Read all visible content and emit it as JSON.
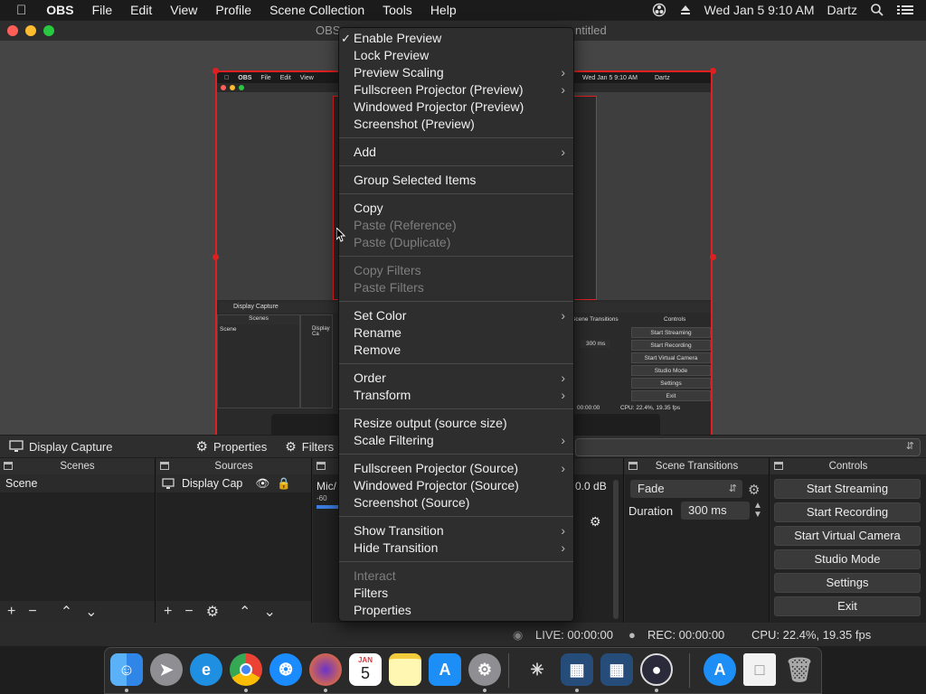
{
  "menubar": {
    "app": "OBS",
    "items": [
      "File",
      "Edit",
      "View",
      "Profile",
      "Scene Collection",
      "Tools",
      "Help"
    ],
    "datetime": "Wed Jan 5  9:10 AM",
    "user": "Dartz"
  },
  "window": {
    "title": "OBS",
    "title_suffix": "ntitled"
  },
  "preview_mini": {
    "menubar": [
      "OBS",
      "File",
      "Edit",
      "View"
    ],
    "datetime": "Wed Jan 5  9:10 AM",
    "user": "Dartz",
    "display_capture": "Display Capture",
    "scenes": "Scenes",
    "scene": "Scene",
    "display_cap": "Display Ca",
    "scene_transitions": "Scene Transitions",
    "controls": "Controls",
    "duration": "300 ms",
    "start_streaming": "Start Streaming",
    "start_recording": "Start Recording",
    "start_virtual_camera": "Start Virtual Camera",
    "studio_mode": "Studio Mode",
    "settings": "Settings",
    "exit": "Exit",
    "rec": "00:00:00",
    "cpu": "CPU: 22.4%, 19.35 fps"
  },
  "context_menu": {
    "enable_preview": "Enable Preview",
    "lock_preview": "Lock Preview",
    "preview_scaling": "Preview Scaling",
    "fullscreen_projector_preview": "Fullscreen Projector (Preview)",
    "windowed_projector_preview": "Windowed Projector (Preview)",
    "screenshot_preview": "Screenshot (Preview)",
    "add": "Add",
    "group_selected": "Group Selected Items",
    "copy": "Copy",
    "paste_reference": "Paste (Reference)",
    "paste_duplicate": "Paste (Duplicate)",
    "copy_filters": "Copy Filters",
    "paste_filters": "Paste Filters",
    "set_color": "Set Color",
    "rename": "Rename",
    "remove": "Remove",
    "order": "Order",
    "transform": "Transform",
    "resize_output": "Resize output (source size)",
    "scale_filtering": "Scale Filtering",
    "fullscreen_projector_source": "Fullscreen Projector (Source)",
    "windowed_projector_source": "Windowed Projector (Source)",
    "screenshot_source": "Screenshot (Source)",
    "show_transition": "Show Transition",
    "hide_transition": "Hide Transition",
    "interact": "Interact",
    "filters": "Filters",
    "properties": "Properties"
  },
  "source_toolbar": {
    "source_name": "Display Capture",
    "properties": "Properties",
    "filters": "Filters"
  },
  "docks": {
    "scenes_title": "Scenes",
    "scene_item": "Scene",
    "sources_title": "Sources",
    "source_item": "Display Cap",
    "mixer_label": "Mic/",
    "mixer_level": "-60",
    "mixer_db": "0.0 dB",
    "transitions_title": "Scene Transitions",
    "transition_value": "Fade",
    "duration_label": "Duration",
    "duration_value": "300 ms",
    "controls_title": "Controls"
  },
  "controls": {
    "start_streaming": "Start Streaming",
    "start_recording": "Start Recording",
    "start_virtual_camera": "Start Virtual Camera",
    "studio_mode": "Studio Mode",
    "settings": "Settings",
    "exit": "Exit"
  },
  "status": {
    "live": "LIVE: 00:00:00",
    "rec": "REC: 00:00:00",
    "cpu": "CPU: 22.4%, 19.35 fps"
  },
  "dock_calendar_day": "5",
  "dock_calendar_month": "JAN"
}
